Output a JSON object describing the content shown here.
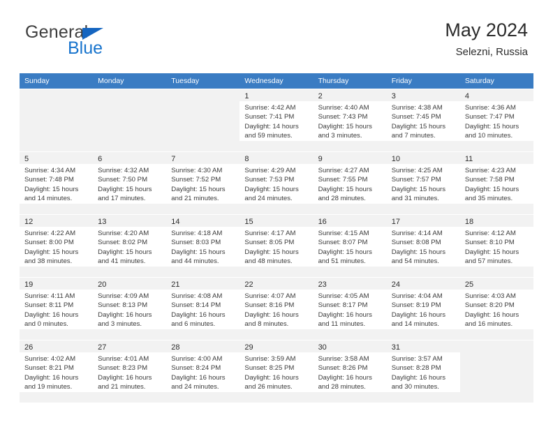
{
  "brand": {
    "name_top": "General",
    "name_bottom": "Blue",
    "triangle_color": "#1565c0",
    "blue_color": "#1874cd"
  },
  "header": {
    "title": "May 2024",
    "subtitle": "Selezni, Russia"
  },
  "theme": {
    "header_row_bg": "#3a7cc3",
    "shaded_cell_bg": "#f2f2f2",
    "text_color": "#3a3a3a"
  },
  "weekday_headers": [
    "Sunday",
    "Monday",
    "Tuesday",
    "Wednesday",
    "Thursday",
    "Friday",
    "Saturday"
  ],
  "labels": {
    "sunrise_prefix": "Sunrise:",
    "sunset_prefix": "Sunset:",
    "daylight_prefix": "Daylight:"
  },
  "weeks": [
    [
      {
        "day": "",
        "sunrise": "",
        "sunset": "",
        "daylight": "",
        "empty": true
      },
      {
        "day": "",
        "sunrise": "",
        "sunset": "",
        "daylight": "",
        "empty": true
      },
      {
        "day": "",
        "sunrise": "",
        "sunset": "",
        "daylight": "",
        "empty": true
      },
      {
        "day": "1",
        "sunrise": "Sunrise: 4:42 AM",
        "sunset": "Sunset: 7:41 PM",
        "daylight": "Daylight: 14 hours and 59 minutes."
      },
      {
        "day": "2",
        "sunrise": "Sunrise: 4:40 AM",
        "sunset": "Sunset: 7:43 PM",
        "daylight": "Daylight: 15 hours and 3 minutes."
      },
      {
        "day": "3",
        "sunrise": "Sunrise: 4:38 AM",
        "sunset": "Sunset: 7:45 PM",
        "daylight": "Daylight: 15 hours and 7 minutes."
      },
      {
        "day": "4",
        "sunrise": "Sunrise: 4:36 AM",
        "sunset": "Sunset: 7:47 PM",
        "daylight": "Daylight: 15 hours and 10 minutes."
      }
    ],
    [
      {
        "day": "5",
        "sunrise": "Sunrise: 4:34 AM",
        "sunset": "Sunset: 7:48 PM",
        "daylight": "Daylight: 15 hours and 14 minutes."
      },
      {
        "day": "6",
        "sunrise": "Sunrise: 4:32 AM",
        "sunset": "Sunset: 7:50 PM",
        "daylight": "Daylight: 15 hours and 17 minutes."
      },
      {
        "day": "7",
        "sunrise": "Sunrise: 4:30 AM",
        "sunset": "Sunset: 7:52 PM",
        "daylight": "Daylight: 15 hours and 21 minutes."
      },
      {
        "day": "8",
        "sunrise": "Sunrise: 4:29 AM",
        "sunset": "Sunset: 7:53 PM",
        "daylight": "Daylight: 15 hours and 24 minutes."
      },
      {
        "day": "9",
        "sunrise": "Sunrise: 4:27 AM",
        "sunset": "Sunset: 7:55 PM",
        "daylight": "Daylight: 15 hours and 28 minutes."
      },
      {
        "day": "10",
        "sunrise": "Sunrise: 4:25 AM",
        "sunset": "Sunset: 7:57 PM",
        "daylight": "Daylight: 15 hours and 31 minutes."
      },
      {
        "day": "11",
        "sunrise": "Sunrise: 4:23 AM",
        "sunset": "Sunset: 7:58 PM",
        "daylight": "Daylight: 15 hours and 35 minutes."
      }
    ],
    [
      {
        "day": "12",
        "sunrise": "Sunrise: 4:22 AM",
        "sunset": "Sunset: 8:00 PM",
        "daylight": "Daylight: 15 hours and 38 minutes."
      },
      {
        "day": "13",
        "sunrise": "Sunrise: 4:20 AM",
        "sunset": "Sunset: 8:02 PM",
        "daylight": "Daylight: 15 hours and 41 minutes."
      },
      {
        "day": "14",
        "sunrise": "Sunrise: 4:18 AM",
        "sunset": "Sunset: 8:03 PM",
        "daylight": "Daylight: 15 hours and 44 minutes."
      },
      {
        "day": "15",
        "sunrise": "Sunrise: 4:17 AM",
        "sunset": "Sunset: 8:05 PM",
        "daylight": "Daylight: 15 hours and 48 minutes."
      },
      {
        "day": "16",
        "sunrise": "Sunrise: 4:15 AM",
        "sunset": "Sunset: 8:07 PM",
        "daylight": "Daylight: 15 hours and 51 minutes."
      },
      {
        "day": "17",
        "sunrise": "Sunrise: 4:14 AM",
        "sunset": "Sunset: 8:08 PM",
        "daylight": "Daylight: 15 hours and 54 minutes."
      },
      {
        "day": "18",
        "sunrise": "Sunrise: 4:12 AM",
        "sunset": "Sunset: 8:10 PM",
        "daylight": "Daylight: 15 hours and 57 minutes."
      }
    ],
    [
      {
        "day": "19",
        "sunrise": "Sunrise: 4:11 AM",
        "sunset": "Sunset: 8:11 PM",
        "daylight": "Daylight: 16 hours and 0 minutes."
      },
      {
        "day": "20",
        "sunrise": "Sunrise: 4:09 AM",
        "sunset": "Sunset: 8:13 PM",
        "daylight": "Daylight: 16 hours and 3 minutes."
      },
      {
        "day": "21",
        "sunrise": "Sunrise: 4:08 AM",
        "sunset": "Sunset: 8:14 PM",
        "daylight": "Daylight: 16 hours and 6 minutes."
      },
      {
        "day": "22",
        "sunrise": "Sunrise: 4:07 AM",
        "sunset": "Sunset: 8:16 PM",
        "daylight": "Daylight: 16 hours and 8 minutes."
      },
      {
        "day": "23",
        "sunrise": "Sunrise: 4:05 AM",
        "sunset": "Sunset: 8:17 PM",
        "daylight": "Daylight: 16 hours and 11 minutes."
      },
      {
        "day": "24",
        "sunrise": "Sunrise: 4:04 AM",
        "sunset": "Sunset: 8:19 PM",
        "daylight": "Daylight: 16 hours and 14 minutes."
      },
      {
        "day": "25",
        "sunrise": "Sunrise: 4:03 AM",
        "sunset": "Sunset: 8:20 PM",
        "daylight": "Daylight: 16 hours and 16 minutes."
      }
    ],
    [
      {
        "day": "26",
        "sunrise": "Sunrise: 4:02 AM",
        "sunset": "Sunset: 8:21 PM",
        "daylight": "Daylight: 16 hours and 19 minutes."
      },
      {
        "day": "27",
        "sunrise": "Sunrise: 4:01 AM",
        "sunset": "Sunset: 8:23 PM",
        "daylight": "Daylight: 16 hours and 21 minutes."
      },
      {
        "day": "28",
        "sunrise": "Sunrise: 4:00 AM",
        "sunset": "Sunset: 8:24 PM",
        "daylight": "Daylight: 16 hours and 24 minutes."
      },
      {
        "day": "29",
        "sunrise": "Sunrise: 3:59 AM",
        "sunset": "Sunset: 8:25 PM",
        "daylight": "Daylight: 16 hours and 26 minutes."
      },
      {
        "day": "30",
        "sunrise": "Sunrise: 3:58 AM",
        "sunset": "Sunset: 8:26 PM",
        "daylight": "Daylight: 16 hours and 28 minutes."
      },
      {
        "day": "31",
        "sunrise": "Sunrise: 3:57 AM",
        "sunset": "Sunset: 8:28 PM",
        "daylight": "Daylight: 16 hours and 30 minutes."
      },
      {
        "day": "",
        "sunrise": "",
        "sunset": "",
        "daylight": "",
        "empty": true
      }
    ]
  ]
}
